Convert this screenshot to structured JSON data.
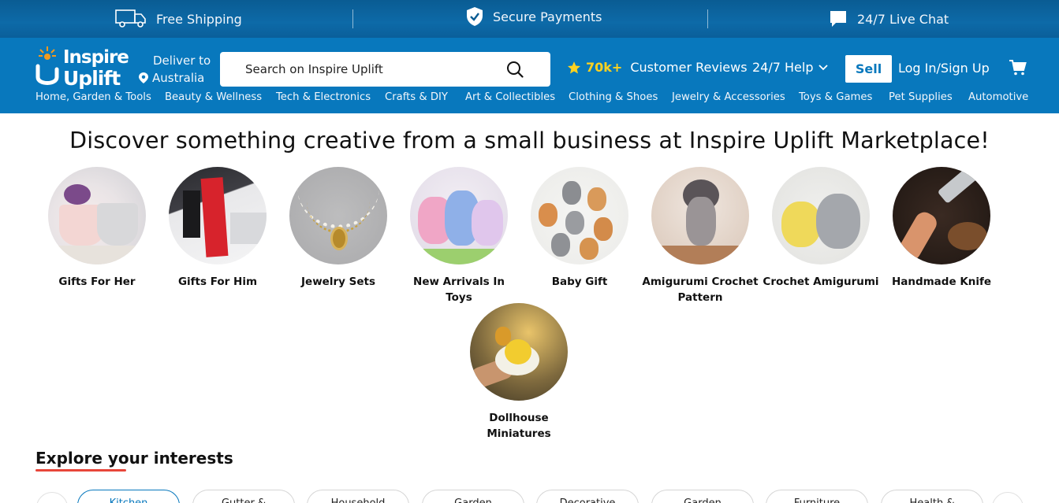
{
  "promo": {
    "shipping": "Free Shipping",
    "shipping_badge": "FREE",
    "payments": "Secure Payments",
    "chat": "24/7 Live Chat"
  },
  "header": {
    "logo_line1": "Inspire",
    "logo_line2": "Uplift",
    "deliver_label": "Deliver to",
    "deliver_location": "Australia",
    "search_placeholder": "Search on Inspire Uplift",
    "reviews_count": "70k+",
    "reviews_label": "Customer Reviews",
    "help_label": "24/7 Help",
    "sell_label": "Sell",
    "login_label": "Log In/Sign Up"
  },
  "nav": [
    "Home, Garden & Tools",
    "Beauty & Wellness",
    "Tech & Electronics",
    "Crafts & DIY",
    "Art & Collectibles",
    "Clothing & Shoes",
    "Jewelry & Accessories",
    "Toys & Games",
    "Pet Supplies",
    "Automotive"
  ],
  "headline": "Discover something creative from a small business at Inspire Uplift Marketplace!",
  "categories": [
    {
      "label": "Gifts For Her"
    },
    {
      "label": "Gifts For Him"
    },
    {
      "label": "Jewelry Sets"
    },
    {
      "label": "New Arrivals In Toys"
    },
    {
      "label": "Baby Gift"
    },
    {
      "label": "Amigurumi Crochet Pattern"
    },
    {
      "label": "Crochet Amigurumi"
    },
    {
      "label": "Handmade Knife"
    },
    {
      "label": "Dollhouse Miniatures"
    }
  ],
  "explore": {
    "title": "Explore your interests",
    "pills": [
      "Kitchen",
      "Gutter &",
      "Household",
      "Garden",
      "Decorative",
      "Garden",
      "Furniture",
      "Health &"
    ]
  },
  "colors": {
    "header_blue": "#0878bd",
    "promo_blue": "#0a5c93",
    "accent_yellow": "#ffd21f",
    "underline_red": "#e8463a"
  }
}
